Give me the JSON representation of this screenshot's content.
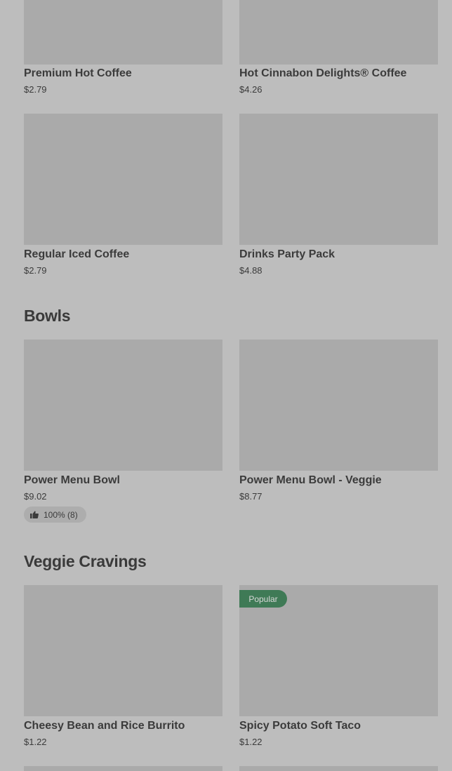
{
  "sections": {
    "bowls_title": "Bowls",
    "veggie_title": "Veggie Cravings"
  },
  "items": [
    {
      "name": "Premium Hot Coffee",
      "price": "$2.79"
    },
    {
      "name": "Hot Cinnabon Delights® Coffee",
      "price": "$4.26"
    },
    {
      "name": "Regular Iced Coffee",
      "price": "$2.79"
    },
    {
      "name": "Drinks Party Pack",
      "price": "$4.88"
    },
    {
      "name": "Power Menu Bowl",
      "price": "$9.02",
      "rating": "100% (8)"
    },
    {
      "name": "Power Menu Bowl - Veggie",
      "price": "$8.77"
    },
    {
      "name": "Cheesy Bean and Rice Burrito",
      "price": "$1.22"
    },
    {
      "name": "Spicy Potato Soft Taco",
      "price": "$1.22",
      "badge": "Popular"
    }
  ],
  "icons": {
    "rating_icon": "thumbs-up-icon"
  }
}
